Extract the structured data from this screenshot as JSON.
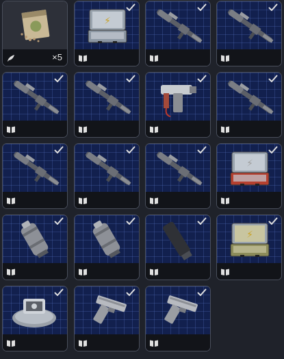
{
  "inventory": {
    "tiles": [
      {
        "name": "seed-packet",
        "type": "consumable",
        "count": "×5",
        "completed": false,
        "icon": "packet-icon"
      },
      {
        "name": "case-gold-emblem",
        "type": "schematic",
        "completed": true,
        "icon": "case-icon"
      },
      {
        "name": "rifle-1",
        "type": "schematic",
        "completed": true,
        "icon": "rifle-icon"
      },
      {
        "name": "rifle-2",
        "type": "schematic",
        "completed": true,
        "icon": "rifle-icon"
      },
      {
        "name": "rifle-3",
        "type": "schematic",
        "completed": true,
        "icon": "rifle-icon"
      },
      {
        "name": "rifle-4",
        "type": "schematic",
        "completed": true,
        "icon": "rifle-icon"
      },
      {
        "name": "pistol-grip-tool",
        "type": "schematic",
        "completed": true,
        "icon": "tool-icon"
      },
      {
        "name": "heavy-rifle",
        "type": "schematic",
        "completed": true,
        "icon": "rifle-icon"
      },
      {
        "name": "rifle-5",
        "type": "schematic",
        "completed": true,
        "icon": "rifle-icon"
      },
      {
        "name": "rifle-6",
        "type": "schematic",
        "completed": true,
        "icon": "rifle-icon"
      },
      {
        "name": "rifle-7",
        "type": "schematic",
        "completed": true,
        "icon": "rifle-icon"
      },
      {
        "name": "case-red",
        "type": "schematic",
        "completed": true,
        "icon": "case-icon"
      },
      {
        "name": "canister-1",
        "type": "schematic",
        "completed": true,
        "icon": "canister-icon"
      },
      {
        "name": "canister-2",
        "type": "schematic",
        "completed": true,
        "icon": "canister-icon"
      },
      {
        "name": "suppressor",
        "type": "schematic",
        "completed": true,
        "icon": "suppressor-icon"
      },
      {
        "name": "case-olive",
        "type": "schematic",
        "completed": true,
        "icon": "case-icon"
      },
      {
        "name": "turret-device",
        "type": "schematic",
        "completed": true,
        "icon": "device-icon"
      },
      {
        "name": "pistol-1",
        "type": "schematic",
        "completed": true,
        "icon": "pistol-icon"
      },
      {
        "name": "pistol-2",
        "type": "schematic",
        "completed": true,
        "icon": "pistol-icon"
      }
    ]
  },
  "colors": {
    "accent": "#e0e0e0",
    "case_gold": "#c9a227",
    "case_red": "#b5402f",
    "case_olive": "#8c8c5a",
    "grid": "#12204e"
  }
}
